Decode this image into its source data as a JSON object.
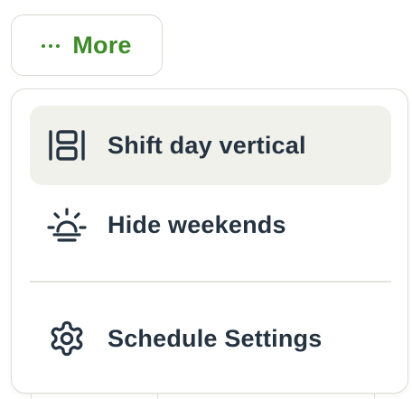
{
  "more_button": {
    "label": "More",
    "icon": "ellipsis-icon",
    "color": "#3f8a2a"
  },
  "menu": {
    "items": [
      {
        "label": "Shift day vertical",
        "icon": "vertical-layout-icon",
        "active": true
      },
      {
        "label": "Hide weekends",
        "icon": "sunset-icon",
        "active": false
      },
      {
        "label": "Schedule Settings",
        "icon": "gear-icon",
        "active": false
      }
    ],
    "text_color": "#253341",
    "active_bg": "#f1f1ec"
  }
}
